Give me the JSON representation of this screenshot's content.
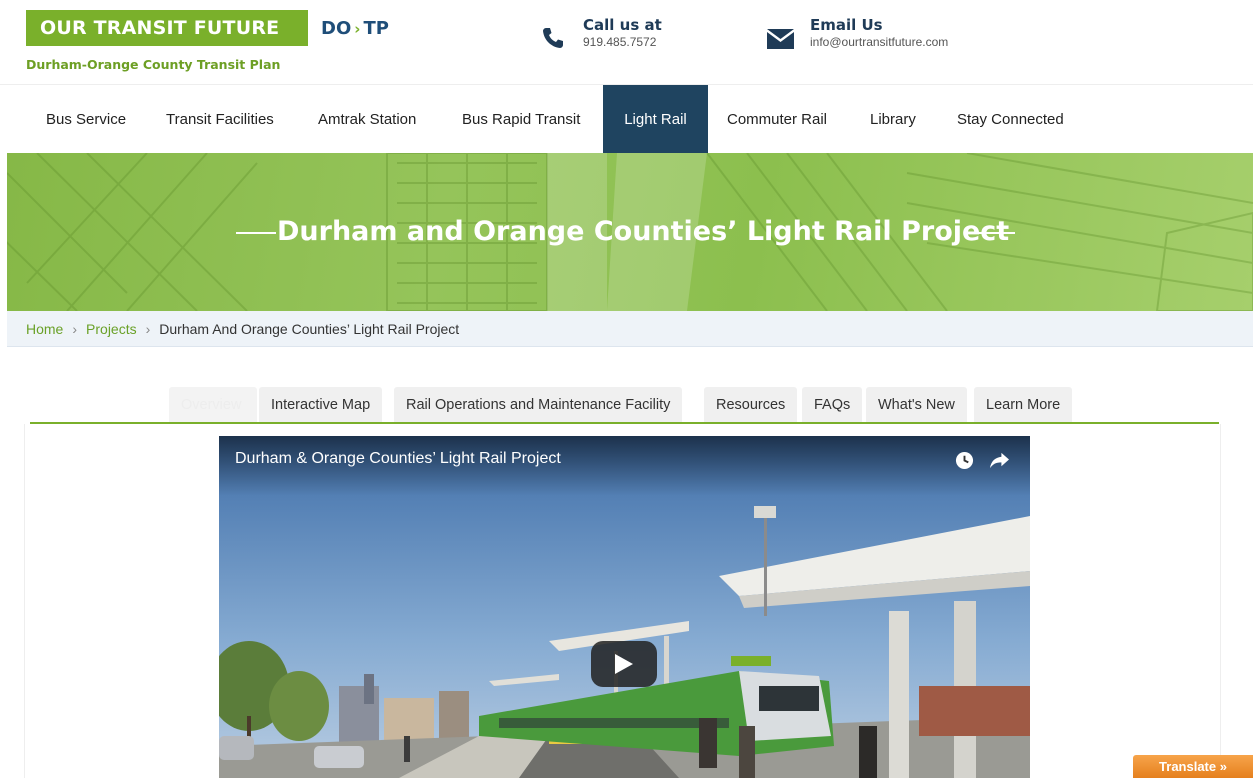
{
  "brand": {
    "name": "OUR TRANSIT FUTURE",
    "short_left": "DO",
    "short_arrow": "›",
    "short_right": "TP",
    "tagline": "Durham-Orange County Transit Plan",
    "accent_color": "#7ab02b",
    "navy_color": "#1f4460"
  },
  "contact": {
    "call_title": "Call us at",
    "call_value": "919.485.7572",
    "call_icon": "phone-icon",
    "email_title": "Email Us",
    "email_value": "info@ourtransitfuture.com",
    "email_icon": "envelope-icon"
  },
  "nav": {
    "items": [
      {
        "label": "Bus Service"
      },
      {
        "label": "Transit Facilities"
      },
      {
        "label": "Amtrak Station"
      },
      {
        "label": "Bus Rapid Transit"
      },
      {
        "label": "Light Rail",
        "active": true
      },
      {
        "label": "Commuter Rail"
      },
      {
        "label": "Library"
      },
      {
        "label": "Stay Connected"
      }
    ]
  },
  "banner": {
    "title": "Durham and Orange Counties’ Light Rail Project"
  },
  "breadcrumb": {
    "home": "Home",
    "sep": "›",
    "projects": "Projects",
    "current": "Durham And Orange Counties’ Light Rail Project"
  },
  "tabs": {
    "items": [
      {
        "label": "Overview",
        "active": true
      },
      {
        "label": "Interactive Map"
      },
      {
        "label": "Rail Operations and Maintenance Facility"
      },
      {
        "label": "Resources"
      },
      {
        "label": "FAQs"
      },
      {
        "label": "What's New"
      },
      {
        "label": "Learn More"
      }
    ]
  },
  "video": {
    "title": "Durham & Orange Counties’ Light Rail Project",
    "icons": [
      "clock-icon",
      "share-icon",
      "play-icon"
    ]
  },
  "translate": {
    "label": "Translate »",
    "color": "#f29a3a"
  }
}
